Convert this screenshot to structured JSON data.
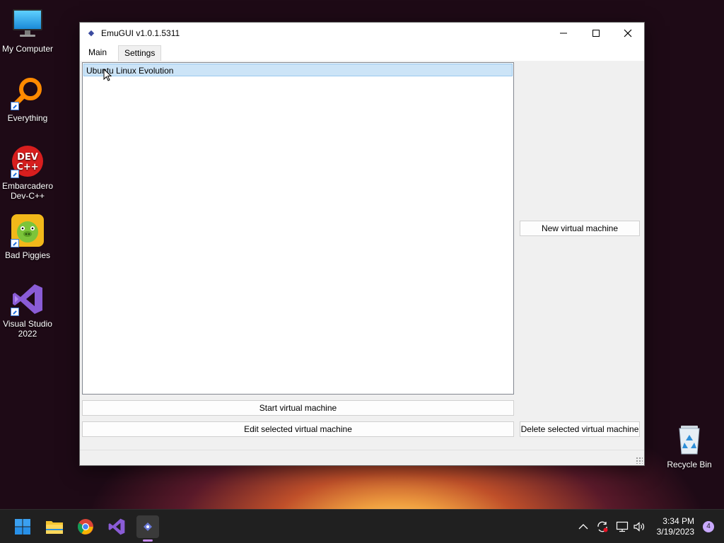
{
  "desktop": {
    "icons": [
      {
        "label": "My Computer"
      },
      {
        "label": "Everything"
      },
      {
        "label": "Embarcadero Dev-C++"
      },
      {
        "label": "Bad Piggies"
      },
      {
        "label": "Visual Studio 2022"
      },
      {
        "label": "Recycle Bin"
      }
    ]
  },
  "window": {
    "title": "EmuGUI v1.0.1.5311",
    "tabs": [
      {
        "label": "Main",
        "active": true
      },
      {
        "label": "Settings",
        "active": false
      }
    ],
    "vm_list": [
      "Ubuntu Linux Evolution"
    ],
    "buttons": {
      "new_vm": "New virtual machine",
      "start_vm": "Start virtual machine",
      "edit_vm": "Edit selected virtual machine",
      "delete_vm": "Delete selected virtual machine"
    }
  },
  "taskbar": {
    "apps": [
      "start-icon",
      "file-explorer-icon",
      "chrome-icon",
      "visual-studio-icon",
      "emugui-icon"
    ],
    "clock": {
      "time": "3:34 PM",
      "date": "3/19/2023"
    },
    "notification_count": "4"
  },
  "colors": {
    "selection": "#cce4f7",
    "selection_border": "#99c9ef",
    "taskbar": "#202020"
  }
}
